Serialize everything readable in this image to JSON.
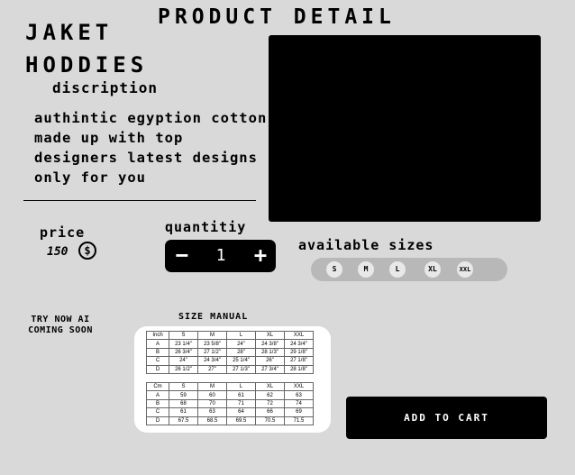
{
  "header": {
    "title": "PRODUCT DETAIL"
  },
  "product": {
    "name_line1": "JAKET",
    "name_line2": "HODDIES",
    "description_label": "discription",
    "description": "authintic egyption cotton made up with top designers latest designs only for you"
  },
  "price": {
    "label": "price",
    "value": "150",
    "currency_symbol": "$"
  },
  "quantity": {
    "label": "quantitiy",
    "minus": "−",
    "value": "1",
    "plus": "+"
  },
  "sizes": {
    "label": "available sizes",
    "options": [
      "S",
      "M",
      "L",
      "XL",
      "XXL"
    ]
  },
  "ai": {
    "line1": "TRY NOW AI",
    "line2": "COMING SOON"
  },
  "size_manual": {
    "label": "SIZE MANUAL",
    "inch": {
      "header": [
        "Inch",
        "S",
        "M",
        "L",
        "XL",
        "XXL"
      ],
      "rows": [
        [
          "A",
          "23 1/4\"",
          "23 5/8\"",
          "24\"",
          "24 3/8\"",
          "24 3/4\""
        ],
        [
          "B",
          "26 3/4\"",
          "27 1/2\"",
          "28\"",
          "28 1/3\"",
          "29 1/8\""
        ],
        [
          "C",
          "24\"",
          "24 3/4\"",
          "25 1/4\"",
          "26\"",
          "27 1/8\""
        ],
        [
          "D",
          "26 1/2\"",
          "27\"",
          "27 1/3\"",
          "27 3/4\"",
          "28 1/8\""
        ]
      ]
    },
    "cm": {
      "header": [
        "Cm",
        "S",
        "M",
        "L",
        "XL",
        "XXL"
      ],
      "rows": [
        [
          "A",
          "59",
          "60",
          "61",
          "62",
          "63"
        ],
        [
          "B",
          "68",
          "70",
          "71",
          "72",
          "74"
        ],
        [
          "C",
          "61",
          "63",
          "64",
          "66",
          "69"
        ],
        [
          "D",
          "67.5",
          "68.5",
          "69.5",
          "70.5",
          "71.5"
        ]
      ]
    }
  },
  "cart": {
    "add_label": "ADD TO CART"
  },
  "colors": {
    "background": "#d9d9d9",
    "primary": "#000000",
    "sizes_bar": "#b8b8b8",
    "card": "#ffffff"
  }
}
